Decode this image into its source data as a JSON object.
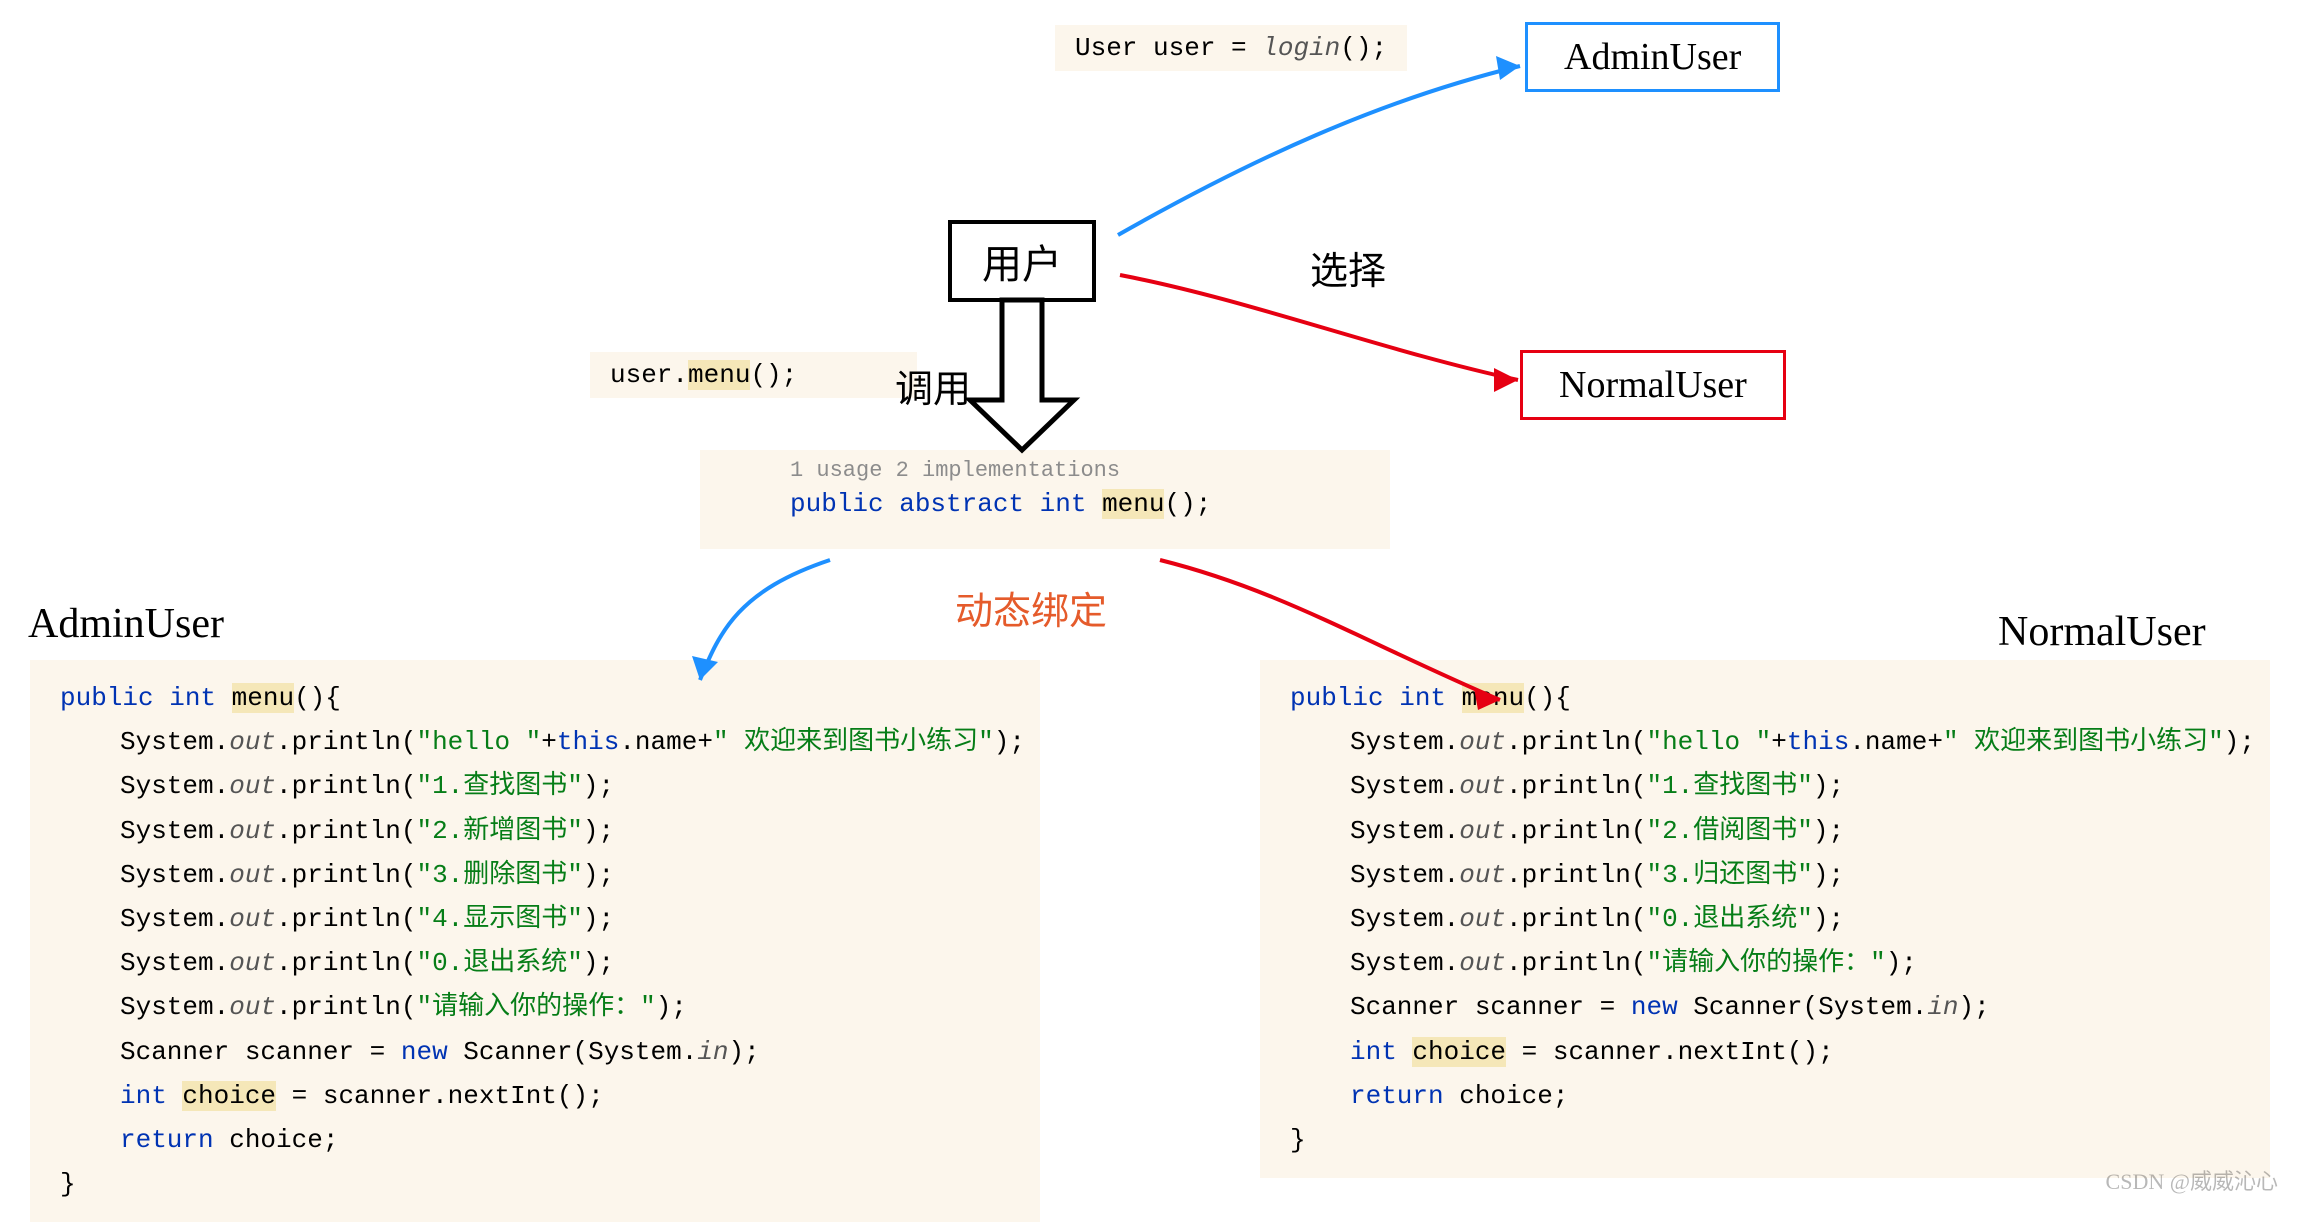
{
  "top_snippet": {
    "type": "User",
    "varname": "user =",
    "call": "login",
    "tail": "();"
  },
  "box_user": "用户",
  "label_select": "选择",
  "box_admin": "AdminUser",
  "box_normal": "NormalUser",
  "call_snippet": {
    "prefix": "user.",
    "method": "menu",
    "tail": "();"
  },
  "label_call": "调用",
  "usages": "1 usage   2 implementations",
  "abstract_line": {
    "a": "public abstract int ",
    "b": "menu",
    "c": "();"
  },
  "label_dynamic": "动态绑定",
  "title_admin": "AdminUser",
  "title_normal": "NormalUser",
  "admin_code": {
    "sig": {
      "a": "public int ",
      "b": "menu",
      "c": "(){"
    },
    "hello": {
      "p1": "System.",
      "p2": "out",
      "p3": ".println(",
      "s1": "\"hello \"",
      "plus1": "+",
      "th": "this",
      "name": ".name+",
      "s2": "\" 欢迎来到图书小练习\"",
      "tail": ");"
    },
    "lines": [
      {
        "pre": "System.",
        "out": "out",
        "mid": ".println(",
        "str": "\"1.查找图书\"",
        "tail": ");"
      },
      {
        "pre": "System.",
        "out": "out",
        "mid": ".println(",
        "str": "\"2.新增图书\"",
        "tail": ");"
      },
      {
        "pre": "System.",
        "out": "out",
        "mid": ".println(",
        "str": "\"3.删除图书\"",
        "tail": ");"
      },
      {
        "pre": "System.",
        "out": "out",
        "mid": ".println(",
        "str": "\"4.显示图书\"",
        "tail": ");"
      },
      {
        "pre": "System.",
        "out": "out",
        "mid": ".println(",
        "str": "\"0.退出系统\"",
        "tail": ");"
      },
      {
        "pre": "System.",
        "out": "out",
        "mid": ".println(",
        "str": "\"请输入你的操作：\"",
        "tail": ");"
      }
    ],
    "scanner": {
      "a": "Scanner scanner = ",
      "nw": "new",
      "b": " Scanner(System.",
      "in": "in",
      "c": ");"
    },
    "choice": {
      "a": "int ",
      "b": "choice",
      "c": " = scanner.nextInt();"
    },
    "ret": {
      "a": "return",
      "b": " choice;"
    },
    "close": "}"
  },
  "normal_code": {
    "sig": {
      "a": "public int ",
      "b": "menu",
      "c": "(){"
    },
    "hello": {
      "p1": "System.",
      "p2": "out",
      "p3": ".println(",
      "s1": "\"hello \"",
      "plus1": "+",
      "th": "this",
      "name": ".name+",
      "s2": "\" 欢迎来到图书小练习\"",
      "tail": ");"
    },
    "lines": [
      {
        "pre": "System.",
        "out": "out",
        "mid": ".println(",
        "str": "\"1.查找图书\"",
        "tail": ");"
      },
      {
        "pre": "System.",
        "out": "out",
        "mid": ".println(",
        "str": "\"2.借阅图书\"",
        "tail": ");"
      },
      {
        "pre": "System.",
        "out": "out",
        "mid": ".println(",
        "str": "\"3.归还图书\"",
        "tail": ");"
      },
      {
        "pre": "System.",
        "out": "out",
        "mid": ".println(",
        "str": "\"0.退出系统\"",
        "tail": ");"
      },
      {
        "pre": "System.",
        "out": "out",
        "mid": ".println(",
        "str": "\"请输入你的操作：\"",
        "tail": ");"
      }
    ],
    "scanner": {
      "a": "Scanner scanner = ",
      "nw": "new",
      "b": " Scanner(System.",
      "in": "in",
      "c": ");"
    },
    "choice": {
      "a": "int ",
      "b": "choice",
      "c": " = scanner.nextInt();"
    },
    "ret": {
      "a": "return",
      "b": " choice;"
    },
    "close": "}"
  },
  "watermark": "CSDN @威威沁心"
}
